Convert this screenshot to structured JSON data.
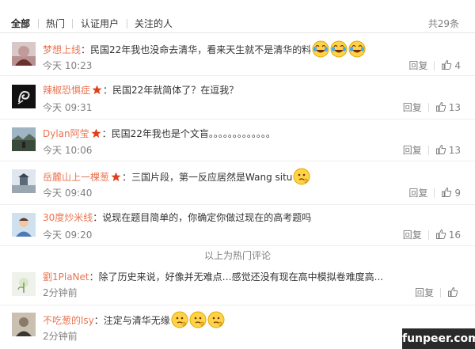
{
  "tabs": [
    {
      "label": "全部",
      "active": true
    },
    {
      "label": "热门",
      "active": false
    },
    {
      "label": "认证用户",
      "active": false
    },
    {
      "label": "关注的人",
      "active": false
    }
  ],
  "total": "共29条",
  "reply_label": "回复",
  "hot_divider": "以上为热门评论",
  "watermark": "funpeer.com",
  "colors": {
    "username": "#eb7350",
    "meta": "#808080",
    "badge": "#e0401a"
  },
  "comments": [
    {
      "user": "梦想上线",
      "badge": false,
      "text": "：民国22年我也没命去清华，看来天生就不是清华的料",
      "emoji": [
        "laugh-cry-emoji",
        "laugh-cry-emoji",
        "laugh-cry-emoji"
      ],
      "time": "今天 10:23",
      "likes": "4"
    },
    {
      "user": "辣椒恐惧症",
      "badge": true,
      "text": "：民国22年就简体了？在逗我？",
      "emoji": [],
      "time": "今天 09:31",
      "likes": "13"
    },
    {
      "user": "Dylan阿莹",
      "badge": true,
      "text": "：民国22年我也是个文盲。。。。。。。。。。。。。",
      "emoji": [],
      "time": "今天 10:06",
      "likes": "13"
    },
    {
      "user": "岳麓山上一棵葱",
      "badge": true,
      "text": "：三国片段，第一反应居然是Wang situ",
      "emoji": [
        "thinking-emoji"
      ],
      "time": "今天 09:40",
      "likes": "9"
    },
    {
      "user": "30度炒米线",
      "badge": false,
      "text": "：说现在题目简单的，你确定你做过现在的高考题吗",
      "emoji": [],
      "time": "今天 09:20",
      "likes": "16"
    },
    {
      "user": "劉1PlaNet",
      "badge": false,
      "text": "：除了历史来说，好像并无难点…感觉还没有现在高中模拟卷难度高...",
      "emoji": [],
      "time": "2分钟前",
      "likes": ""
    },
    {
      "user": "不吃葱的lsy",
      "badge": false,
      "text": "：注定与清华无缘",
      "emoji": [
        "thinking-emoji",
        "thinking-emoji",
        "thinking-emoji"
      ],
      "time": "2分钟前",
      "likes": ""
    }
  ]
}
